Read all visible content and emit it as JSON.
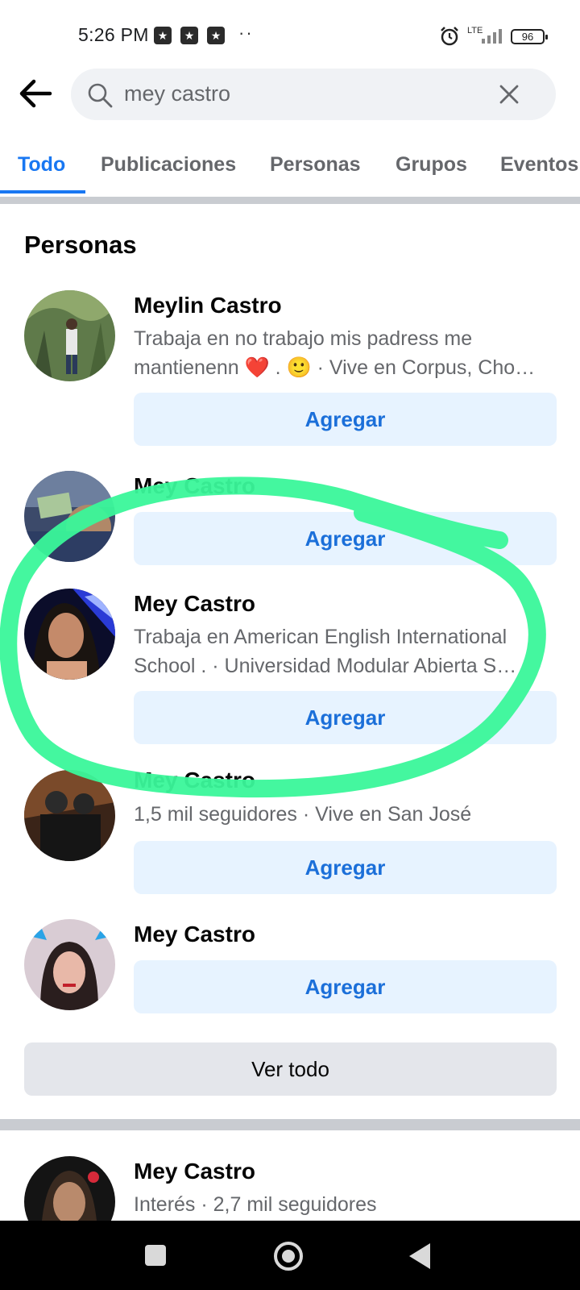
{
  "status_bar": {
    "time": "5:26 PM",
    "notification_icons": [
      "star-badge-icon",
      "star-badge-icon",
      "star-badge-icon"
    ],
    "more_dots": "··",
    "network": "LTE",
    "battery": "96"
  },
  "search": {
    "query": "mey castro",
    "icon": "search-icon"
  },
  "tabs": [
    {
      "label": "Todo",
      "active": true
    },
    {
      "label": "Publicaciones",
      "active": false
    },
    {
      "label": "Personas",
      "active": false
    },
    {
      "label": "Grupos",
      "active": false
    },
    {
      "label": "Eventos",
      "active": false
    }
  ],
  "people_section": {
    "title": "Personas",
    "add_label": "Agregar",
    "people": [
      {
        "name": "Meylin Castro",
        "info_line1": "Trabaja en no trabajo mis padress me",
        "info_line2": "mantienenn ❤️ . 🙂 · Vive en Corpus, Cho…"
      },
      {
        "name": "Mey Castro"
      },
      {
        "name": "Mey Castro",
        "info_line1": "Trabaja en American English International",
        "info_line2": "School . · Universidad Modular Abierta S…"
      },
      {
        "name": "Mey Castro",
        "info_line1": "1,5 mil seguidores · Vive en San José"
      },
      {
        "name": "Mey Castro"
      }
    ],
    "see_all_label": "Ver todo"
  },
  "next_result": {
    "name": "Mey Castro",
    "info": "Interés · 2,7 mil seguidores"
  },
  "colors": {
    "accent": "#1877f2",
    "button_bg": "#e7f3ff",
    "annotation": "#3af79a"
  }
}
